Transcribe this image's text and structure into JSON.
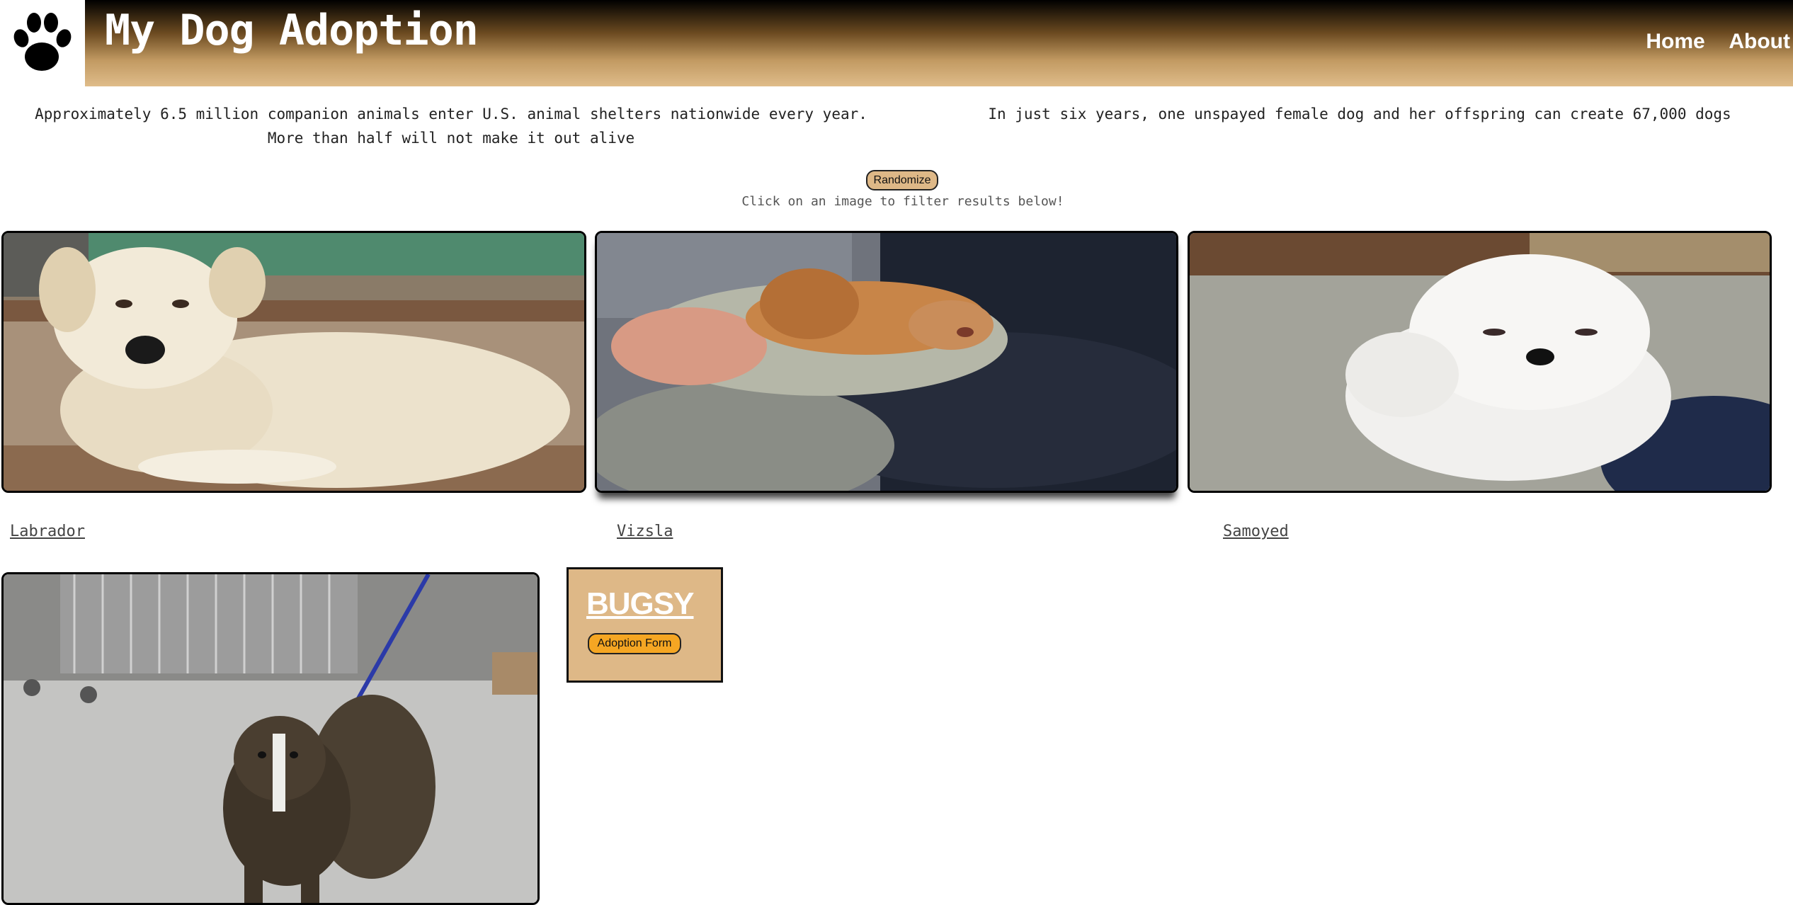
{
  "header": {
    "title": "My Dog Adoption",
    "logo_icon": "paw-print-icon",
    "nav": [
      "Home",
      "About"
    ]
  },
  "facts": {
    "left": "Approximately 6.5 million companion animals enter U.S. animal shelters nationwide every year. More than half will not make it out alive",
    "right": "In just six years, one unspayed female dog and her offspring can create 67,000 dogs"
  },
  "controls": {
    "randomize_label": "Randomize",
    "hint": "Click on an image to filter results below!"
  },
  "breeds": [
    {
      "name": "Labrador"
    },
    {
      "name": "Vizsla"
    },
    {
      "name": "Samoyed"
    }
  ],
  "featured": {
    "name": "BUGSY",
    "button_label": "Adoption Form"
  },
  "colors": {
    "accent_tan": "#deb887",
    "adopt_button": "#f5a623",
    "header_gradient_top": "#000000",
    "header_gradient_bottom": "#dfbc8a"
  }
}
